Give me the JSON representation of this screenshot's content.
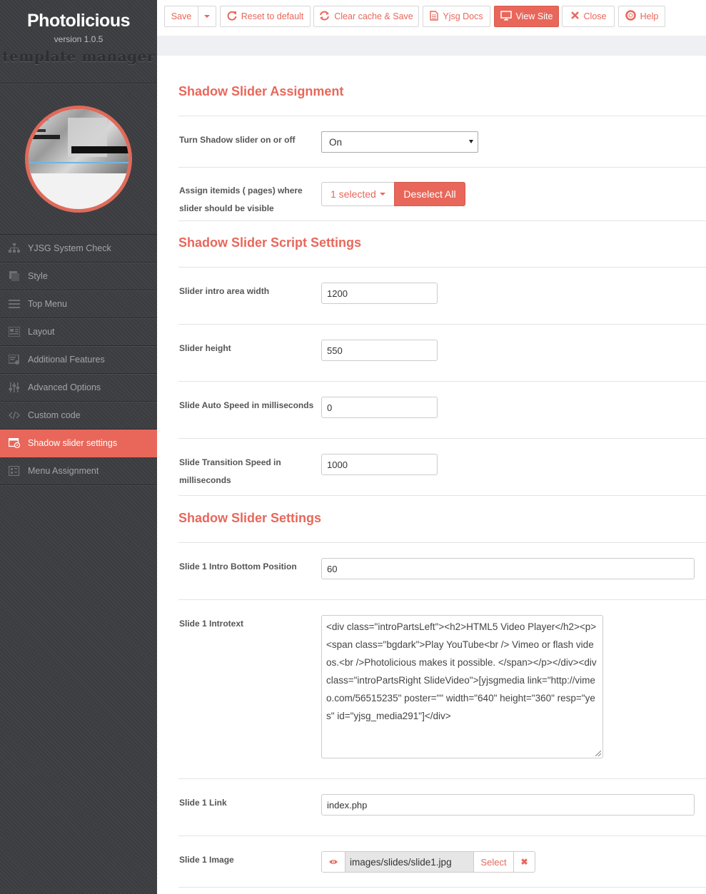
{
  "brand": {
    "title": "Photolicious",
    "version": "version 1.0.5",
    "subtitle": "template manager"
  },
  "sidebar": {
    "items": [
      {
        "label": "YJSG System Check",
        "icon": "sitemap-icon"
      },
      {
        "label": "Style",
        "icon": "style-square-icon"
      },
      {
        "label": "Top Menu",
        "icon": "menu-lines-icon"
      },
      {
        "label": "Layout",
        "icon": "layout-icon"
      },
      {
        "label": "Additional Features",
        "icon": "features-icon"
      },
      {
        "label": "Advanced Options",
        "icon": "sliders-icon"
      },
      {
        "label": "Custom code",
        "icon": "code-icon"
      },
      {
        "label": "Shadow slider settings",
        "icon": "slider-settings-icon",
        "active": true
      },
      {
        "label": "Menu Assignment",
        "icon": "menu-assignment-icon"
      }
    ]
  },
  "toolbar": {
    "save": "Save",
    "reset": "Reset to default",
    "clear_cache": "Clear cache & Save",
    "docs": "Yjsg Docs",
    "view_site": "View Site",
    "close": "Close",
    "help": "Help"
  },
  "colors": {
    "accent": "#e8675a",
    "sidebar_bg": "#3d3e42"
  },
  "sections": {
    "assignment": {
      "title": "Shadow Slider Assignment",
      "toggle_label": "Turn Shadow slider on or off",
      "toggle_value": "On",
      "itemids_label": "Assign itemids ( pages) where slider should be visible",
      "itemids_value": "1 selected",
      "deselect": "Deselect All"
    },
    "script": {
      "title": "Shadow Slider Script Settings",
      "intro_width_label": "Slider intro area width",
      "intro_width": "1200",
      "height_label": "Slider height",
      "height": "550",
      "auto_speed_label": "Slide Auto Speed in milliseconds",
      "auto_speed": "0",
      "transition_label": "Slide Transition Speed in milliseconds",
      "transition": "1000"
    },
    "settings": {
      "title": "Shadow Slider Settings",
      "bottom_pos_label": "Slide 1 Intro Bottom Position",
      "bottom_pos": "60",
      "introtext_label": "Slide 1 Introtext",
      "introtext": "<div class=\"introPartsLeft\"><h2>HTML5 Video Player</h2><p><span class=\"bgdark\">Play YouTube<br /> Vimeo or flash videos.<br />Photolicious makes it possible. </span></p></div><div class=\"introPartsRight SlideVideo\">[yjsgmedia link=\"http://vimeo.com/56515235\" poster=\"\" width=\"640\" height=\"360\" resp=\"yes\" id=\"yjsg_media291\"]</div>",
      "link_label": "Slide 1 Link",
      "link": "index.php",
      "image_label": "Slide 1 Image",
      "image": "images/slides/slide1.jpg",
      "image_select": "Select"
    }
  }
}
